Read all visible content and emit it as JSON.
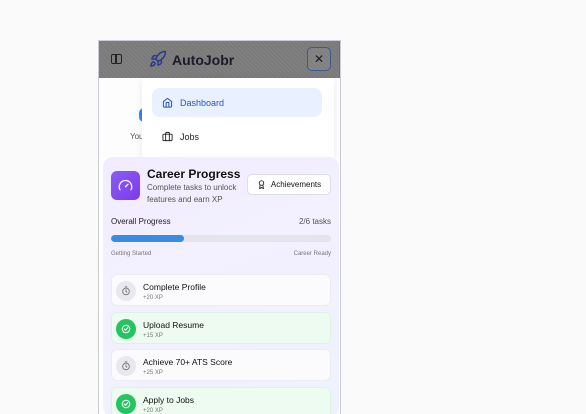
{
  "header": {
    "brand": "AutoJobr",
    "close_glyph": "✕"
  },
  "background": {
    "you_text": "You"
  },
  "menu": {
    "items": [
      {
        "label": "Dashboard",
        "icon": "home-icon",
        "active": true
      },
      {
        "label": "Jobs",
        "icon": "briefcase-icon",
        "active": false
      }
    ]
  },
  "career": {
    "title": "Career Progress",
    "subtitle": "Complete tasks to unlock features and earn XP",
    "achievements_label": "Achievements",
    "overall_label": "Overall Progress",
    "count_label": "2/6 tasks",
    "progress_fraction": 0.333,
    "start_label": "Getting Started",
    "end_label": "Career Ready",
    "tasks": [
      {
        "name": "Complete Profile",
        "xp": "+20 XP",
        "done": false
      },
      {
        "name": "Upload Resume",
        "xp": "+15 XP",
        "done": true
      },
      {
        "name": "Achieve 70+ ATS Score",
        "xp": "+25 XP",
        "done": false
      },
      {
        "name": "Apply to Jobs",
        "xp": "+20 XP",
        "done": true
      }
    ]
  },
  "colors": {
    "accent": "#3b8be0",
    "done": "#22c55e",
    "purple": "#7c3aed"
  }
}
